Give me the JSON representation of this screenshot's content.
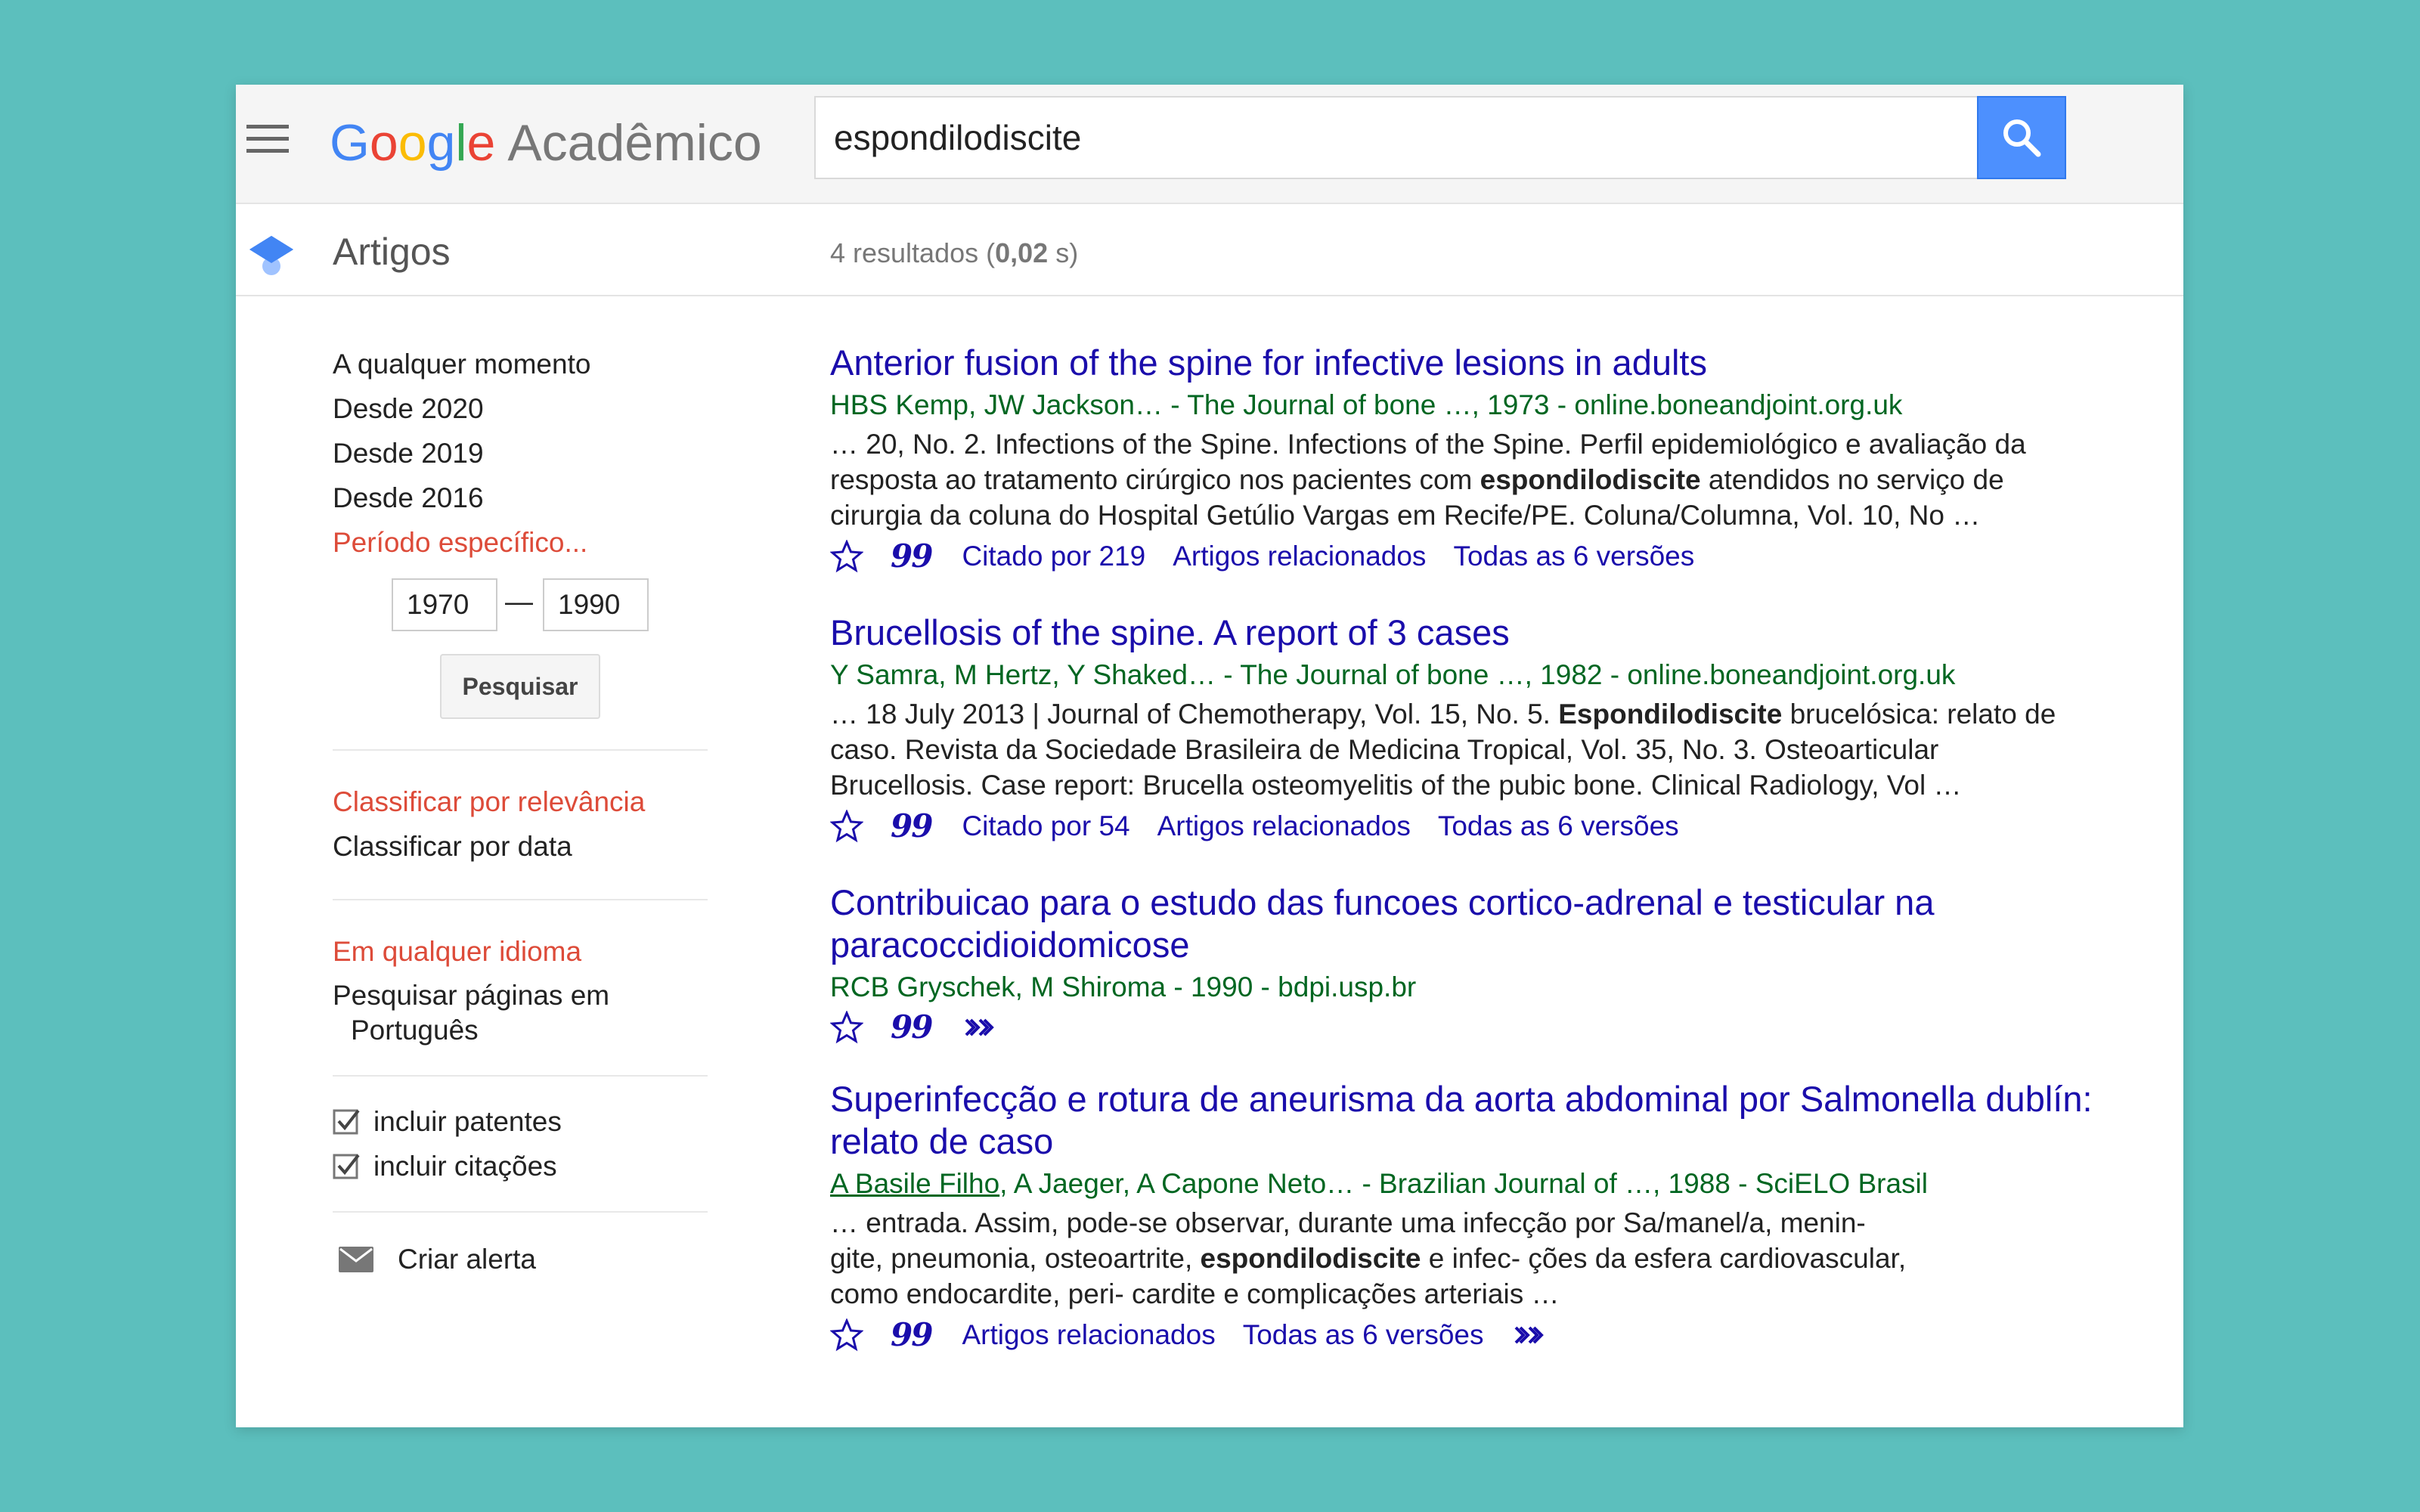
{
  "header": {
    "logo": {
      "G": "G",
      "o1": "o",
      "o2": "o",
      "g": "g",
      "l": "l",
      "e": "e",
      "product": "Acadêmico"
    },
    "search_value": "espondilodiscite"
  },
  "subheader": {
    "section": "Artigos",
    "stats_prefix": "4 resultados (",
    "stats_time": "0,02",
    "stats_suffix": " s)"
  },
  "sidebar": {
    "time_links": [
      "A qualquer momento",
      "Desde 2020",
      "Desde 2019",
      "Desde 2016",
      "Período específico..."
    ],
    "year_from": "1970",
    "year_sep": "—",
    "year_to": "1990",
    "search_button": "Pesquisar",
    "sort": [
      "Classificar por relevância",
      "Classificar por data"
    ],
    "lang_any": "Em qualquer idioma",
    "lang_pt_line1": "Pesquisar páginas em",
    "lang_pt_line2": "Português",
    "include_patents": "incluir patentes",
    "include_citations": "incluir citações",
    "create_alert": "Criar alerta"
  },
  "results": [
    {
      "title": "Anterior fusion of the spine for infective lesions in adults",
      "meta": "HBS Kemp, JW Jackson… - The Journal of bone …, 1973 - online.boneandjoint.org.uk",
      "snippet": [
        "… 20, No. 2. Infections of the Spine. Infections of the Spine. Perfil epidemiológico e avaliação da",
        "resposta ao tratamento cirúrgico nos pacientes com ",
        "espondilodiscite",
        " atendidos no serviço de",
        "cirurgia da coluna do Hospital Getúlio Vargas em Recife/PE. Coluna/Columna, Vol. 10, No …"
      ],
      "cited": "Citado por 219",
      "related": "Artigos relacionados",
      "versions": "Todas as 6 versões"
    },
    {
      "title": "Brucellosis of the spine. A report of 3 cases",
      "meta": "Y Samra, M Hertz, Y Shaked… - The Journal of bone …, 1982 - online.boneandjoint.org.uk",
      "snippet": [
        "… 18 July 2013 | Journal of Chemotherapy, Vol. 15, No. 5. ",
        "Espondilodiscite",
        " brucelósica: relato de",
        "caso. Revista da Sociedade Brasileira de Medicina Tropical, Vol. 35, No. 3. Osteoarticular",
        "Brucellosis. Case report: Brucella osteomyelitis of the pubic bone. Clinical Radiology, Vol …"
      ],
      "cited": "Citado por 54",
      "related": "Artigos relacionados",
      "versions": "Todas as 6 versões"
    },
    {
      "title_line1": "Contribuicao para o estudo das funcoes cortico-adrenal e testicular na",
      "title_line2": "paracoccidioidomicose",
      "meta": "RCB Gryschek, M Shiroma - 1990 - bdpi.usp.br"
    },
    {
      "title_line1": "Superinfecção e rotura de aneurisma da aorta abdominal por Salmonella dublín:",
      "title_line2": "relato de caso",
      "meta_author_link": "A Basile Filho",
      "meta_rest": ", A Jaeger, A Capone Neto… - Brazilian Journal of …, 1988 - SciELO Brasil",
      "snippet": [
        "… entrada. Assim, pode-se observar, durante uma infecção por Sa/manel/a, menin-",
        "gite, pneumonia, osteoartrite, ",
        "espondilodiscite",
        " e infec- ções da esfera cardiovascular,",
        "como endocardite, peri- cardite e complicações arteriais …"
      ],
      "related": "Artigos relacionados",
      "versions": "Todas as 6 versões"
    }
  ],
  "icons": {
    "quote": "99"
  },
  "colors": {
    "background": "#5cbfbd",
    "link": "#1a0dab",
    "meta": "#006621",
    "active": "#dd4b39",
    "search_button": "#4d90fe"
  }
}
